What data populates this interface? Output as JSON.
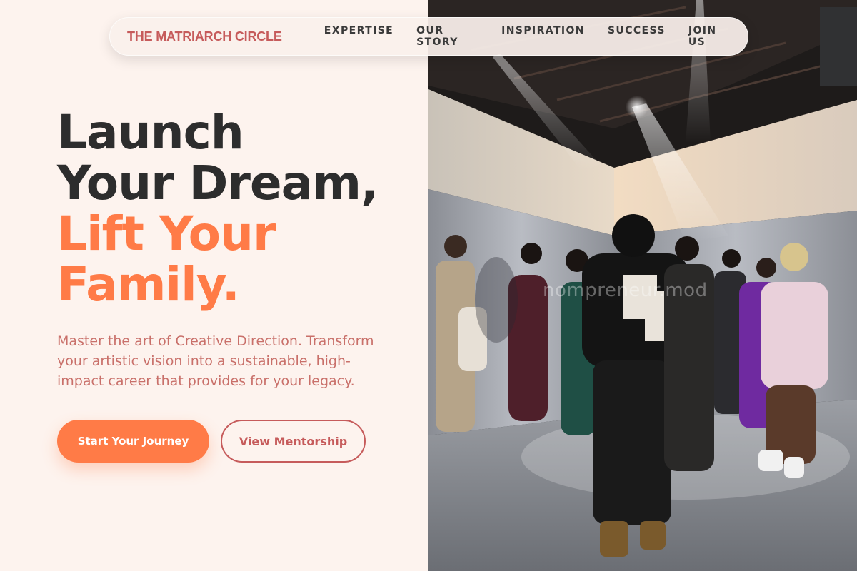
{
  "nav": {
    "brand": "THE MATRIARCH CIRCLE",
    "links": [
      "EXPERTISE",
      "OUR STORY",
      "INSPIRATION",
      "SUCCESS",
      "JOIN US"
    ]
  },
  "hero": {
    "title_line1": "Launch",
    "title_line2": "Your Dream,",
    "title_line3": "Lift Your",
    "title_line4": "Family.",
    "subtitle": "Master the art of Creative Direction. Transform your artistic vision into a sustainable, high-impact career that provides for your legacy.",
    "primary_cta": "Start Your Journey",
    "secondary_cta": "View Mentorship"
  },
  "photo": {
    "watermark": "nompreneur.mod",
    "description_icon": "fashion-show-photo"
  },
  "colors": {
    "background": "#fdf3ee",
    "brand": "#c65b5b",
    "accent": "#ff7b47",
    "text_dark": "#2d2d2d"
  }
}
